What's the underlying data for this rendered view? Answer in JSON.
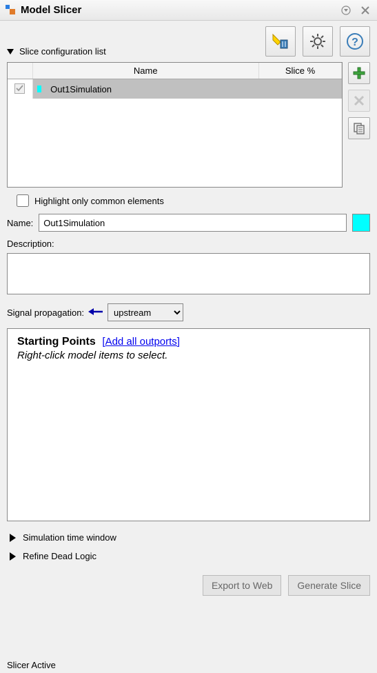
{
  "titlebar": {
    "title": "Model Slicer"
  },
  "section_config_list": "Slice configuration list",
  "table": {
    "col_name": "Name",
    "col_slice": "Slice %",
    "rows": [
      {
        "name": "Out1Simulation",
        "slice_pct": ""
      }
    ]
  },
  "highlight_common": "Highlight only common elements",
  "form": {
    "name_label": "Name:",
    "name_value": "Out1Simulation",
    "desc_label": "Description:",
    "desc_value": "",
    "sigprop_label": "Signal propagation:",
    "sigprop_value": "upstream",
    "sigprop_options": [
      "upstream"
    ],
    "color": "#00ffff"
  },
  "starting_points": {
    "title": "Starting Points",
    "link": "[Add all outports]",
    "subtitle": "Right-click model items to select."
  },
  "collapsibles": {
    "time_window": "Simulation time window",
    "refine_dead": "Refine Dead Logic"
  },
  "buttons": {
    "export_web": "Export to Web",
    "generate_slice": "Generate Slice"
  },
  "status": "Slicer Active"
}
